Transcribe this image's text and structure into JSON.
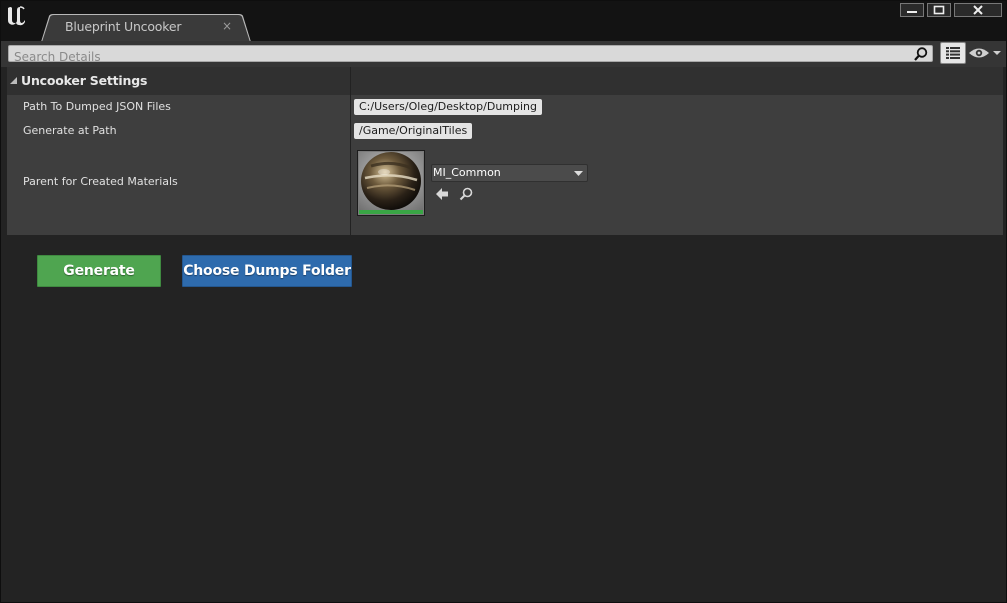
{
  "tab": {
    "title": "Blueprint Uncooker",
    "close": "×"
  },
  "search": {
    "placeholder": "Search Details",
    "value": ""
  },
  "category": {
    "title": "Uncooker Settings"
  },
  "properties": [
    {
      "label": "Path To Dumped JSON Files",
      "value": "C:/Users/Oleg/Desktop/Dumping"
    },
    {
      "label": "Generate at Path",
      "value": "/Game/OriginalTiles"
    },
    {
      "label": "Parent for Created Materials",
      "value": "MI_Common"
    }
  ],
  "buttons": {
    "generate": "Generate",
    "choose_dumps": "Choose Dumps Folder"
  },
  "colors": {
    "generate": "#4fa550",
    "choose_dumps": "#2e6bad",
    "thumbnail_bar": "#39a545"
  },
  "icons": {
    "logo": "unreal-logo-icon",
    "search": "search-icon",
    "list": "list-view-icon",
    "eye": "eye-icon",
    "use_selected": "arrow-left-icon",
    "browse": "search-icon",
    "minimize": "minimize-icon",
    "maximize": "maximize-icon",
    "close": "close-icon"
  }
}
